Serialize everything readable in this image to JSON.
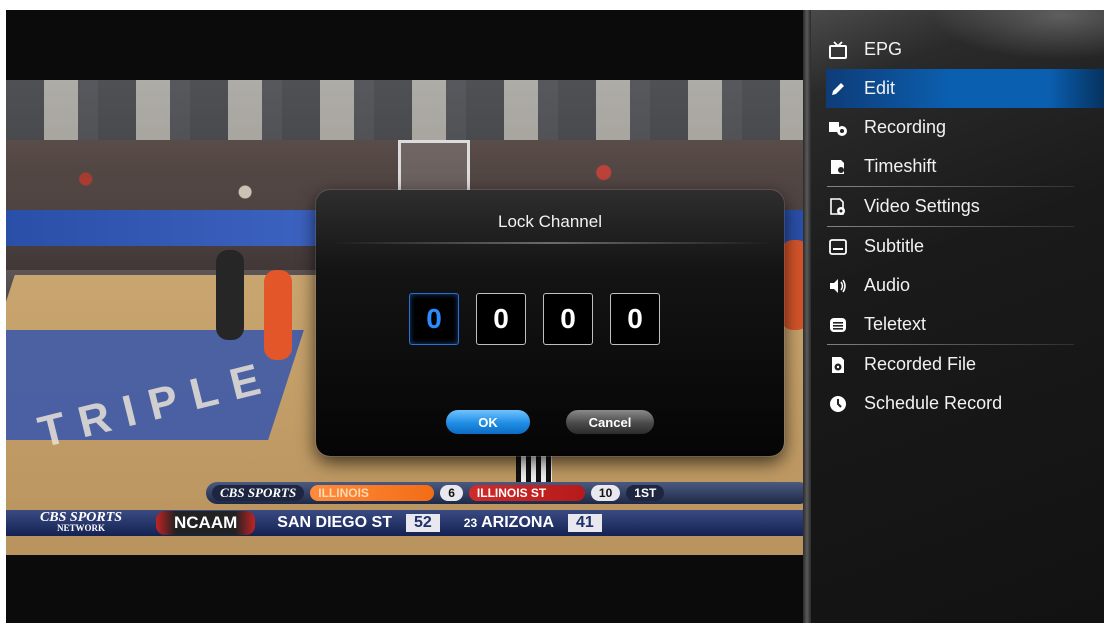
{
  "dialog": {
    "title": "Lock Channel",
    "pin_digits": [
      "0",
      "0",
      "0",
      "0"
    ],
    "ok_label": "OK",
    "cancel_label": "Cancel"
  },
  "menu": {
    "items": [
      {
        "label": "EPG",
        "icon": "tv-icon"
      },
      {
        "label": "Edit",
        "icon": "pencil-icon",
        "active": true
      },
      {
        "label": "Recording",
        "icon": "recording-icon"
      },
      {
        "label": "Timeshift",
        "icon": "timeshift-icon"
      },
      {
        "label": "Video Settings",
        "icon": "video-settings-icon"
      },
      {
        "label": "Subtitle",
        "icon": "subtitle-icon"
      },
      {
        "label": "Audio",
        "icon": "speaker-icon"
      },
      {
        "label": "Teletext",
        "icon": "teletext-icon"
      },
      {
        "label": "Recorded File",
        "icon": "recorded-file-icon"
      },
      {
        "label": "Schedule Record",
        "icon": "schedule-icon"
      }
    ],
    "accent_color": "#0b5fb0"
  },
  "video": {
    "scorebug_top": {
      "network": "CBS SPORTS",
      "team1": "ILLINOIS",
      "score1": "6",
      "team2": "ILLINOIS ST",
      "score2": "10",
      "period": "1ST"
    },
    "ticker": {
      "network": "CBS SPORTS",
      "network_sub": "NETWORK",
      "league": "NCAAM",
      "team1": "SAN DIEGO ST",
      "score1": "52",
      "rank2": "23",
      "team2": "ARIZONA",
      "score2": "41"
    },
    "court_text": "TRIPLE"
  }
}
